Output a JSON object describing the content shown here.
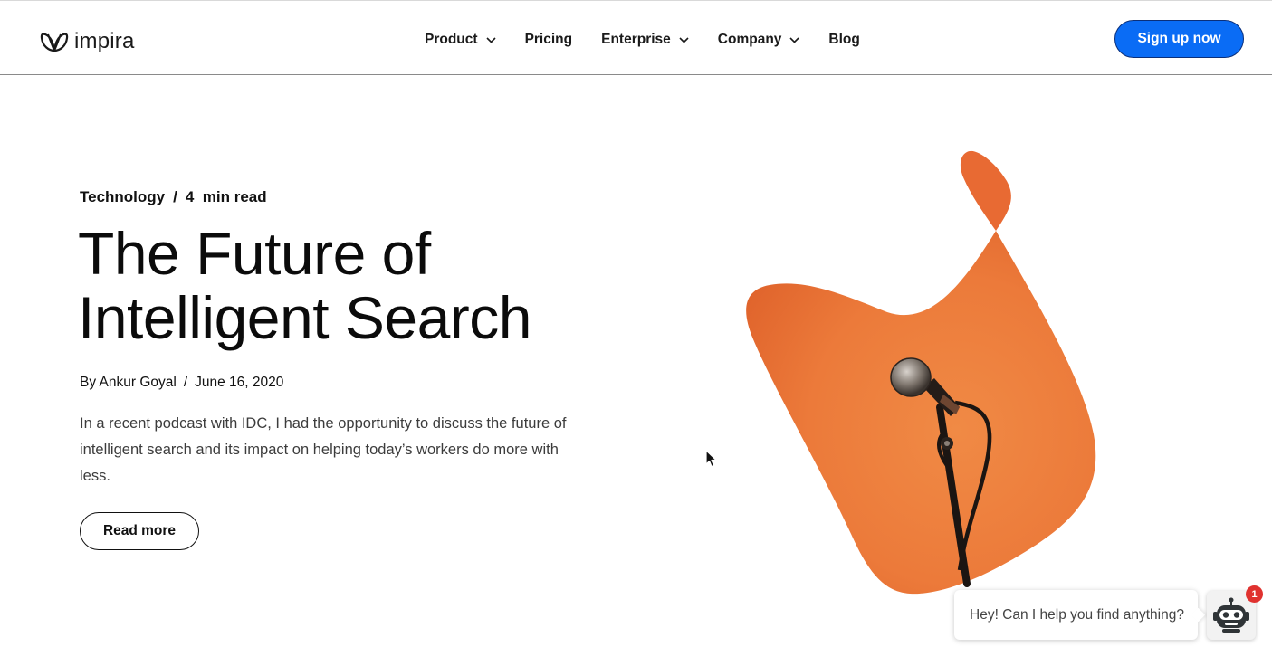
{
  "header": {
    "logo_text": "impira",
    "nav": [
      {
        "label": "Product",
        "has_dropdown": true
      },
      {
        "label": "Pricing",
        "has_dropdown": false
      },
      {
        "label": "Enterprise",
        "has_dropdown": true
      },
      {
        "label": "Company",
        "has_dropdown": true
      },
      {
        "label": "Blog",
        "has_dropdown": false
      }
    ],
    "signup_label": "Sign up now"
  },
  "article": {
    "category": "Technology",
    "separator": "/",
    "read_time": "4  min read",
    "title_line1": "The Future of",
    "title_line2": "Intelligent Search",
    "author": "By Ankur Goyal",
    "date": "June 16, 2020",
    "excerpt": "In a recent podcast with IDC, I had the opportunity to discuss the future of intelligent search and its impact on helping today’s workers do more with less.",
    "read_more_label": "Read more"
  },
  "chat": {
    "prompt": "Hey! Can I help you find anything?",
    "badge_count": "1"
  },
  "colors": {
    "accent_blue": "#0a6cf5",
    "hero_orange": "#ec7a3a",
    "badge_red": "#e0322f"
  },
  "icons": [
    "logo-mark-icon",
    "chevron-down-icon",
    "microphone-image",
    "chatbot-icon",
    "mouse-cursor-icon"
  ]
}
